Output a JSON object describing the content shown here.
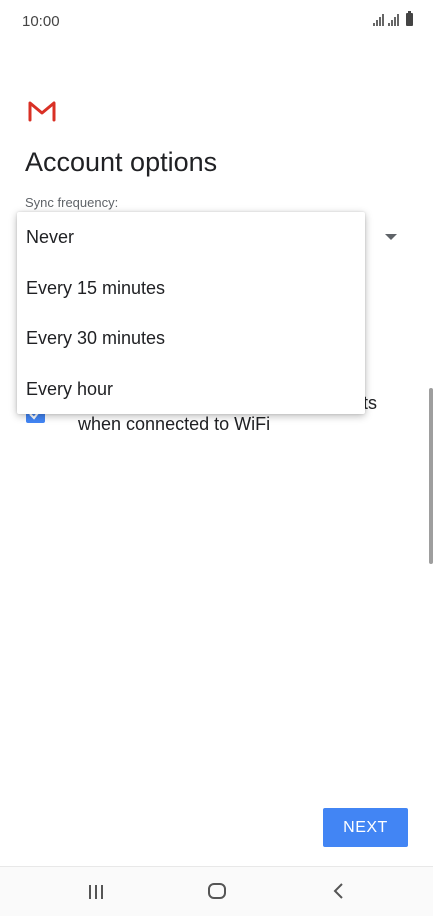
{
  "status_bar": {
    "time": "10:00"
  },
  "page": {
    "title": "Account options",
    "sync_label": "Sync frequency:"
  },
  "sync_dropdown": {
    "options": [
      "Never",
      "Every 15 minutes",
      "Every 30 minutes",
      "Every hour"
    ]
  },
  "checkbox": {
    "checked": true,
    "text_visible_tail": "ts",
    "text_line2": "when connected to WiFi"
  },
  "footer": {
    "next_label": "NEXT"
  },
  "colors": {
    "accent": "#4285f4",
    "gmail_red": "#d93025"
  }
}
